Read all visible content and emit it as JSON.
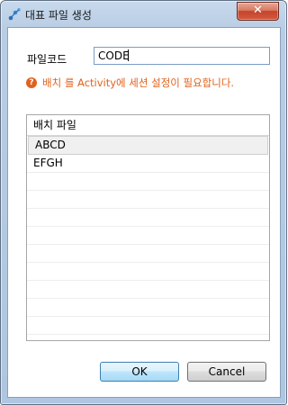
{
  "window": {
    "title": "대표 파일 생성",
    "close_label": "✕"
  },
  "form": {
    "code_label": "파일코드",
    "code_value": "CODE",
    "warning_icon": "?",
    "warning_text": "배치 를 Activity에 세션 설정이 필요합니다."
  },
  "list": {
    "header": "배치 파일",
    "items": [
      "ABCD",
      "EFGH"
    ],
    "selected_index": 0
  },
  "buttons": {
    "ok": "OK",
    "cancel": "Cancel"
  },
  "colors": {
    "warning": "#e0621d",
    "close": "#c4442c"
  }
}
